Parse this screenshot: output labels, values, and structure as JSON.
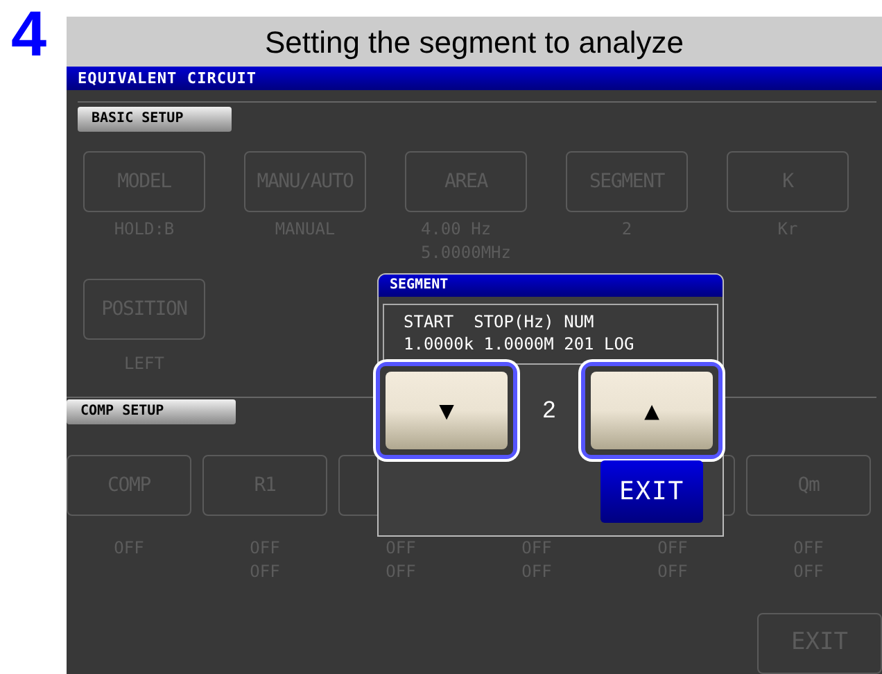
{
  "step": "4",
  "heading": "Setting the segment to analyze",
  "screen": {
    "title": "EQUIVALENT CIRCUIT",
    "basic_setup": {
      "label": "BASIC SETUP",
      "items": [
        {
          "label": "MODEL",
          "values": [
            "HOLD:B"
          ]
        },
        {
          "label": "MANU/AUTO",
          "values": [
            "MANUAL"
          ]
        },
        {
          "label": "AREA",
          "values": [
            "4.00 Hz",
            "5.0000MHz"
          ]
        },
        {
          "label": "SEGMENT",
          "values": [
            "2"
          ]
        },
        {
          "label": "K",
          "values": [
            "Kr"
          ]
        },
        {
          "label": "POSITION",
          "values": [
            "LEFT"
          ]
        }
      ]
    },
    "comp_setup": {
      "label": "COMP SETUP",
      "items": [
        {
          "label": "COMP",
          "values": [
            "OFF"
          ]
        },
        {
          "label": "R1",
          "values": [
            "OFF",
            "OFF"
          ]
        },
        {
          "values": [
            "OFF",
            "OFF"
          ]
        },
        {
          "values": [
            "OFF",
            "OFF"
          ]
        },
        {
          "values": [
            "OFF",
            "OFF"
          ]
        },
        {
          "label": "Qm",
          "values": [
            "OFF",
            "OFF"
          ]
        }
      ]
    },
    "exit": "EXIT",
    "dialog": {
      "title": "SEGMENT",
      "header": "START  STOP(Hz) NUM",
      "row": "1.0000k 1.0000M 201 LOG",
      "down": {
        "symbol": "▼",
        "highlighted": true
      },
      "value": "2",
      "up": {
        "symbol": "▲",
        "highlighted": true
      },
      "exit": "EXIT"
    }
  }
}
